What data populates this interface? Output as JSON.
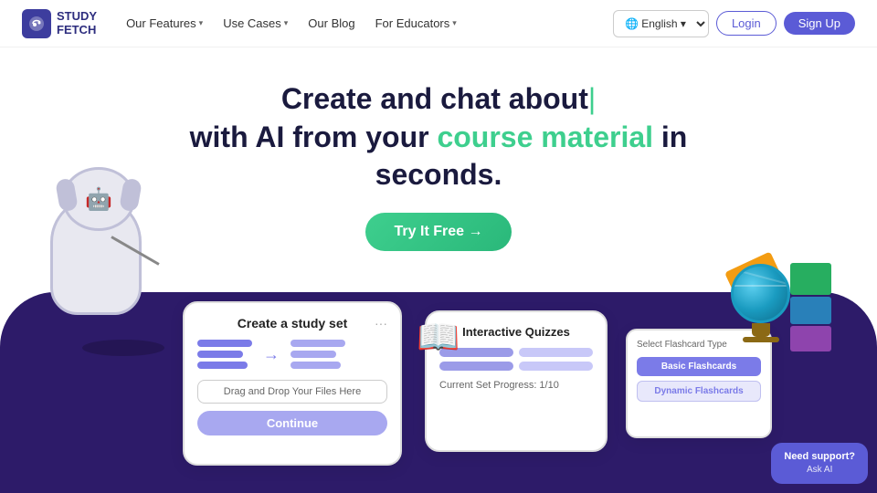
{
  "brand": {
    "name_line1": "STUDY",
    "name_line2": "FETCH"
  },
  "nav": {
    "features_label": "Our Features",
    "use_cases_label": "Use Cases",
    "blog_label": "Our Blog",
    "educators_label": "For Educators",
    "lang_label": "🌐 English ▾",
    "login_label": "Login",
    "signup_label": "Sign Up"
  },
  "hero": {
    "line1": "Create and chat about",
    "line1_cursor": "|",
    "line2_prefix": "with AI from your ",
    "line2_highlight": "course material",
    "line2_suffix": " in",
    "line3": "seconds.",
    "cta_label": "Try It Free →"
  },
  "card1": {
    "title": "Create a study set",
    "dots": "···",
    "drag_text": "Drag and Drop Your Files Here",
    "continue_label": "Continue"
  },
  "card2": {
    "title": "Interactive Quizzes",
    "progress": "Current Set Progress: 1/10"
  },
  "card3": {
    "title": "Select Flashcard Type",
    "basic_label": "Basic Flashcards",
    "dynamic_label": "Dynamic Flashcards"
  },
  "support": {
    "label": "Need support?",
    "sub": "Ask AI"
  }
}
